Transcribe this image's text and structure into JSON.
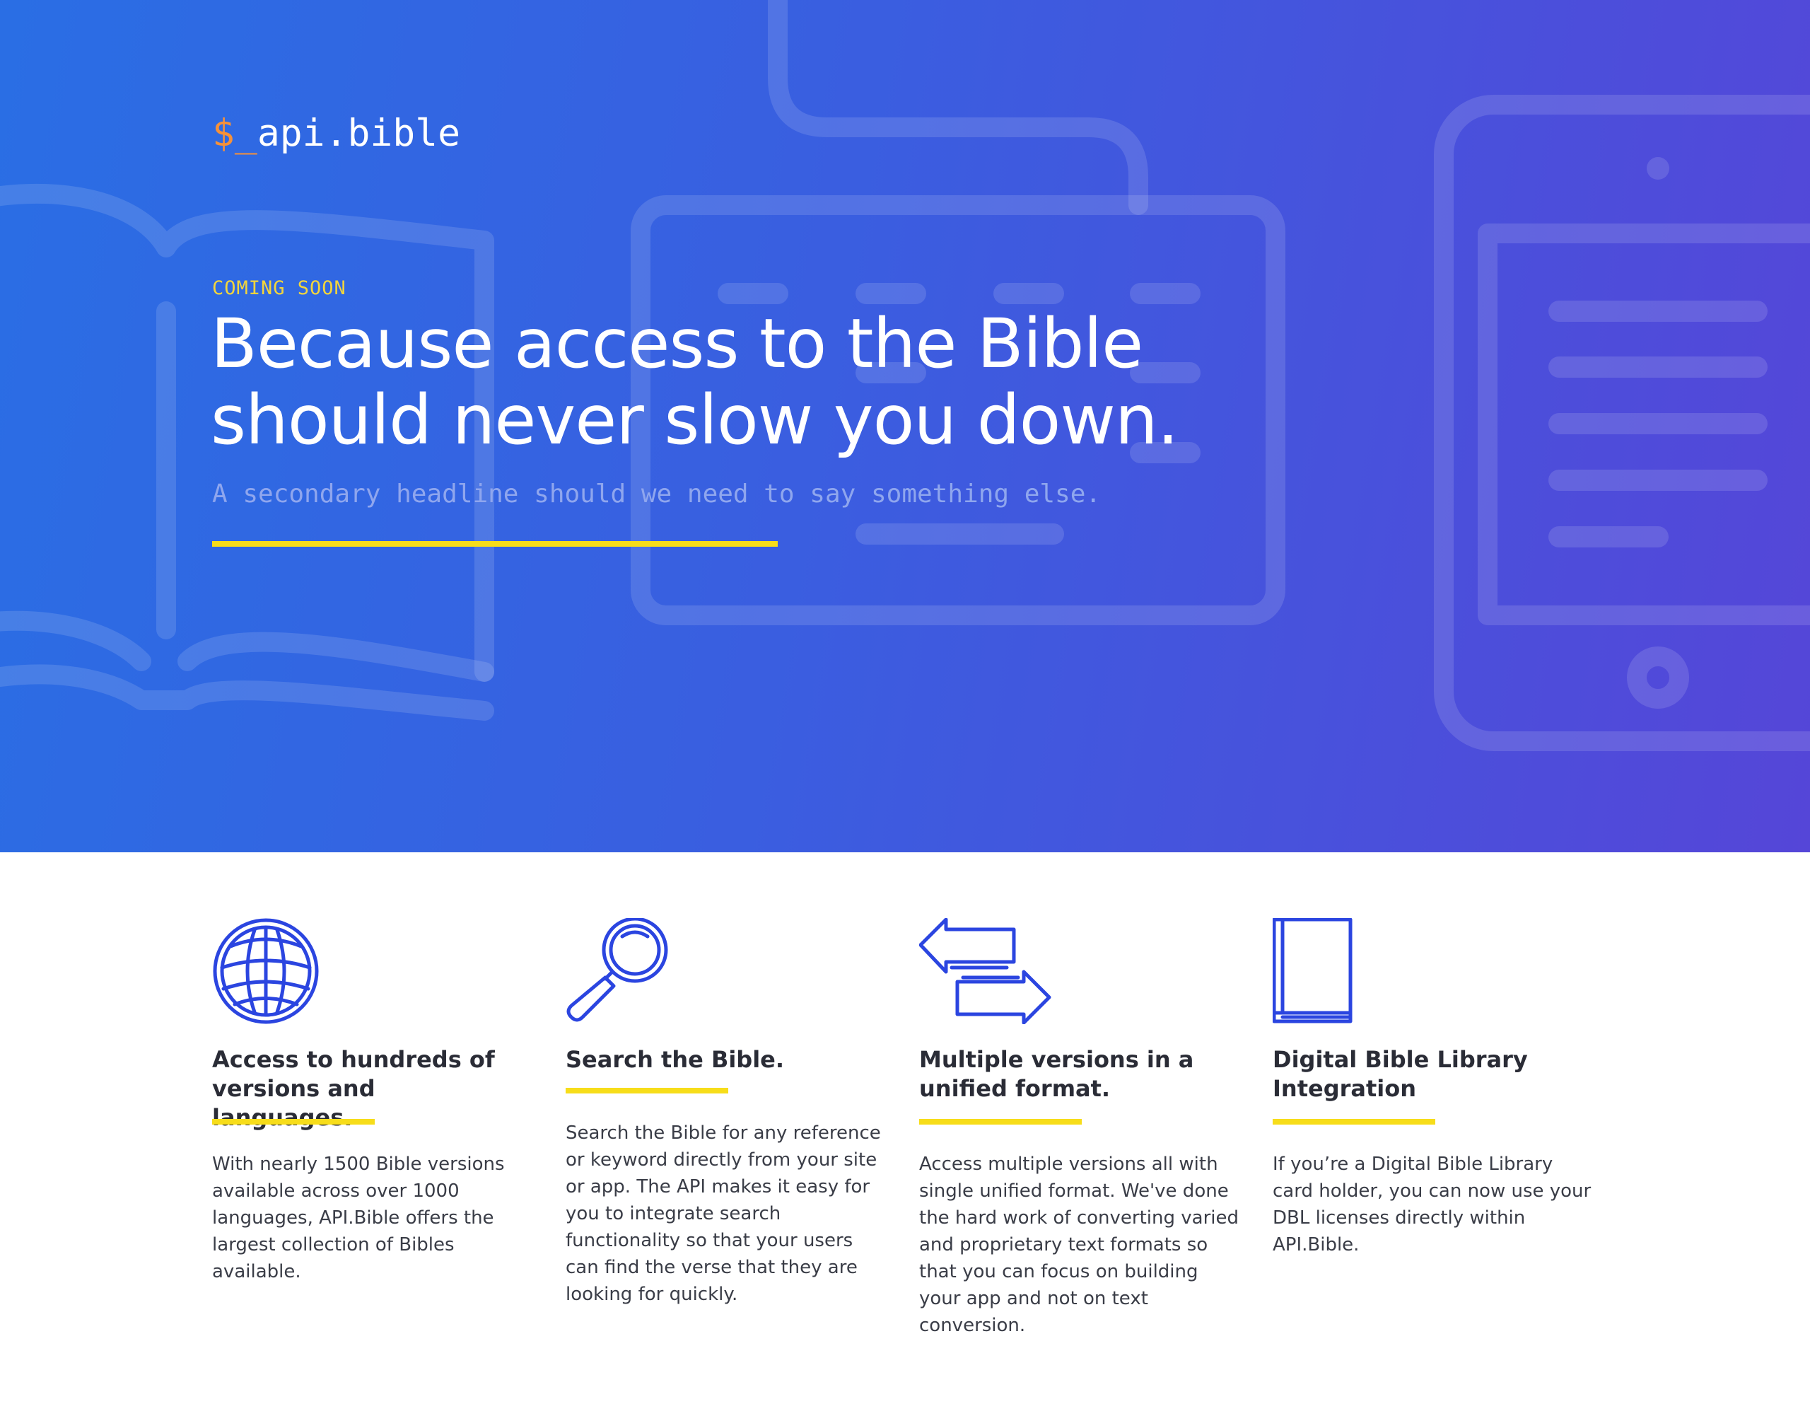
{
  "brand": {
    "prompt": "$_",
    "name": "api.bible"
  },
  "hero": {
    "eyebrow": "COMING SOON",
    "headline": "Because access to the Bible should never slow you down.",
    "subheadline": "A secondary headline should we need to say something else."
  },
  "colors": {
    "hero_gradient_start": "#2a6ee4",
    "hero_gradient_end": "#5546d8",
    "accent_yellow": "#f7dd1a",
    "prompt_orange": "#f5913a",
    "icon_blue": "#2b45e0",
    "text_dark": "#2a2c36"
  },
  "features": [
    {
      "icon": "globe-icon",
      "title": "Access to hundreds of versions and languages.",
      "body": "With nearly 1500 Bible versions available across over 1000 languages, API.Bible offers the largest collection of Bibles available."
    },
    {
      "icon": "magnifying-glass-icon",
      "title": "Search the Bible.",
      "body": "Search the Bible for any reference or keyword directly from your site or app. The API makes it easy for you to integrate search functionality so that your users can find the verse that they are looking for quickly."
    },
    {
      "icon": "swap-arrows-icon",
      "title": "Multiple versions in a unified format.",
      "body": "Access multiple versions all with single unified format. We've done the hard work of converting varied and proprietary text formats so that you can focus on building your app and not on text conversion."
    },
    {
      "icon": "book-icon",
      "title": "Digital Bible Library Integration",
      "body": "If you’re a Digital Bible Library card holder, you can now use your DBL licenses directly within API.Bible."
    }
  ]
}
